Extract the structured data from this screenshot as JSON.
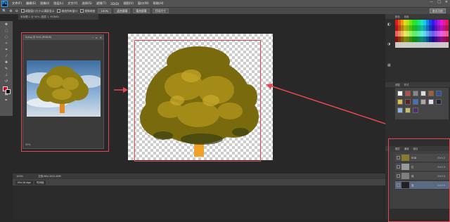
{
  "app": {
    "logo": "Ps"
  },
  "menu": [
    "文件(F)",
    "编辑(E)",
    "图像(I)",
    "图层(L)",
    "文字(Y)",
    "选择(S)",
    "滤镜(T)",
    "3D(D)",
    "视图(V)",
    "窗口(W)",
    "帮助(H)"
  ],
  "window_controls": [
    "—",
    "□",
    "✕"
  ],
  "options": {
    "auto_checkbox_label": "调整窗口大小以满屏显示",
    "zoom_all_label": "缩放所有窗口",
    "scrubby_label": "细微缩放",
    "btn1": "100%",
    "btn2": "适合屏幕",
    "btn3": "填充屏幕",
    "btn4": "打印尺寸",
    "workspace": "基本功能"
  },
  "document_tab": "未标题-1 @ 50% (图层 1, RGB/8)",
  "float_window": {
    "title": "4.png @ 50% (RGB/8)",
    "zoom": "50%"
  },
  "status_bar": {
    "zoom": "100%",
    "doc": "文档:864.2K/2.48M"
  },
  "mini_bridge": [
    "Mini Bridge",
    "时间轴"
  ],
  "panels": {
    "color_tabs": [
      "颜色",
      "色板"
    ],
    "style_tabs": [
      "调整",
      "样式"
    ],
    "layer_tabs": [
      "图层",
      "通道",
      "路径"
    ]
  },
  "layers": [
    {
      "name": "RGB",
      "shortcut": "Ctrl+2"
    },
    {
      "name": "红",
      "shortcut": "Ctrl+3"
    },
    {
      "name": "绿",
      "shortcut": "Ctrl+4"
    },
    {
      "name": "蓝",
      "shortcut": "Ctrl+5"
    }
  ],
  "colors": {
    "accent_red": "#e8474f",
    "fg_color": "#e00020",
    "bg_color": "#000000"
  }
}
